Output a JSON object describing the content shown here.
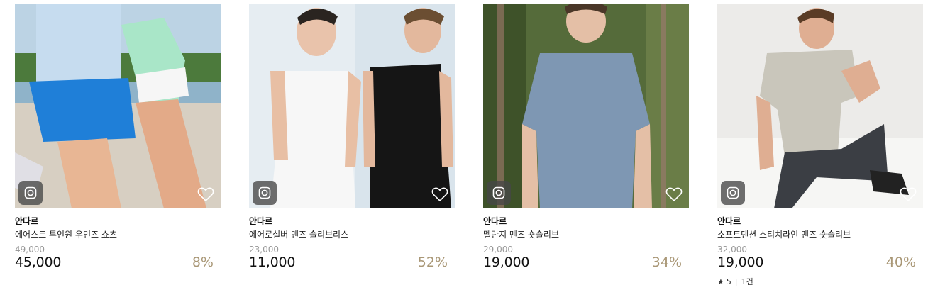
{
  "products": [
    {
      "brand": "안다르",
      "name": "에어스트 투인원 우먼즈 쇼츠",
      "original_price": "49,000",
      "price": "45,000",
      "discount": "8%"
    },
    {
      "brand": "안다르",
      "name": "에어로실버 맨즈 슬리브리스",
      "original_price": "23,000",
      "price": "11,000",
      "discount": "52%"
    },
    {
      "brand": "안다르",
      "name": "멜란지 맨즈 숏슬리브",
      "original_price": "29,000",
      "price": "19,000",
      "discount": "34%"
    },
    {
      "brand": "안다르",
      "name": "소프트텐션 스티치라인 맨즈 숏슬리브",
      "original_price": "32,000",
      "price": "19,000",
      "discount": "40%",
      "rating": {
        "star": "★",
        "score": "5",
        "count": "1건"
      }
    }
  ],
  "icons": {
    "snap": "instagram-icon",
    "wish": "heart-outline-icon",
    "star": "star-icon"
  },
  "colors": {
    "discount": "#a99776",
    "original_price": "#999999"
  }
}
